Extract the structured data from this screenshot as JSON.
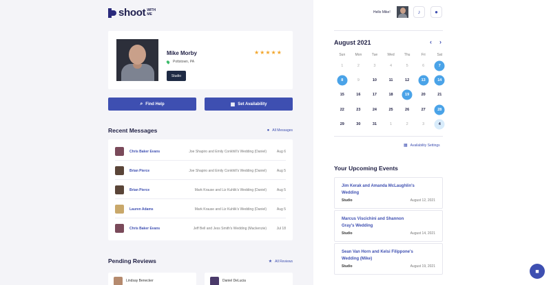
{
  "brand": {
    "name": "shoot",
    "suffix_line1": "WITH",
    "suffix_line2": "ME"
  },
  "profile": {
    "name": "Mike Morby",
    "location": "Pottstown, PA",
    "rating_stars": "★★★★★",
    "rating": 5,
    "tag": "Studio"
  },
  "actions": {
    "find_help": "Find Help",
    "set_availability": "Set Availability"
  },
  "messages": {
    "title": "Recent Messages",
    "link": "All Messages",
    "items": [
      {
        "name": "Chris Baker Evans",
        "subject": "Joe Shapiro and Emily Conkhill's Wedding (Daniel)",
        "date": "Aug 6"
      },
      {
        "name": "Brian Pierce",
        "subject": "Joe Shapiro and Emily Conkhill's Wedding (Daniel)",
        "date": "Aug 5"
      },
      {
        "name": "Brian Pierce",
        "subject": "Mark Krause and Liz Kuhlik's Wedding (Daniel)",
        "date": "Aug 5"
      },
      {
        "name": "Lauren Adams",
        "subject": "Mark Krause and Liz Kuhlik's Wedding (Daniel)",
        "date": "Aug 5"
      },
      {
        "name": "Chris Baker Evans",
        "subject": "Jeff Bell and Jess Smith's Wedding (Mackenzie)",
        "date": "Jul 18"
      }
    ]
  },
  "reviews": {
    "title": "Pending Reviews",
    "link": "All Reviews",
    "items": [
      {
        "name": "Lindsay Benecker"
      },
      {
        "name": "Daniel DeLucia"
      }
    ]
  },
  "header": {
    "greeting": "Hello Mike!"
  },
  "calendar": {
    "month": "August 2021",
    "prev": "‹",
    "next": "›",
    "weekdays": [
      "Sun",
      "Mon",
      "Tue",
      "Wed",
      "Thu",
      "Fri",
      "Sat"
    ],
    "weeks": [
      [
        {
          "d": "1",
          "s": "muted"
        },
        {
          "d": "2",
          "s": "muted"
        },
        {
          "d": "3",
          "s": "muted"
        },
        {
          "d": "4",
          "s": "muted"
        },
        {
          "d": "5",
          "s": "muted"
        },
        {
          "d": "6",
          "s": "muted"
        },
        {
          "d": "7",
          "s": "hl"
        }
      ],
      [
        {
          "d": "8",
          "s": "hl"
        },
        {
          "d": "9",
          "s": "muted"
        },
        {
          "d": "10",
          "s": ""
        },
        {
          "d": "11",
          "s": ""
        },
        {
          "d": "12",
          "s": ""
        },
        {
          "d": "13",
          "s": "hl"
        },
        {
          "d": "14",
          "s": "hl"
        }
      ],
      [
        {
          "d": "15",
          "s": ""
        },
        {
          "d": "16",
          "s": ""
        },
        {
          "d": "17",
          "s": ""
        },
        {
          "d": "18",
          "s": ""
        },
        {
          "d": "19",
          "s": "hl"
        },
        {
          "d": "20",
          "s": ""
        },
        {
          "d": "21",
          "s": ""
        }
      ],
      [
        {
          "d": "22",
          "s": ""
        },
        {
          "d": "23",
          "s": ""
        },
        {
          "d": "24",
          "s": ""
        },
        {
          "d": "25",
          "s": ""
        },
        {
          "d": "26",
          "s": ""
        },
        {
          "d": "27",
          "s": ""
        },
        {
          "d": "28",
          "s": "hl"
        }
      ],
      [
        {
          "d": "29",
          "s": ""
        },
        {
          "d": "30",
          "s": ""
        },
        {
          "d": "31",
          "s": ""
        },
        {
          "d": "1",
          "s": "muted"
        },
        {
          "d": "2",
          "s": "muted"
        },
        {
          "d": "3",
          "s": "muted"
        },
        {
          "d": "4",
          "s": "lt"
        }
      ]
    ],
    "settings_link": "Availability Settings"
  },
  "events": {
    "title": "Your Upcoming Events",
    "items": [
      {
        "name": "Jim Kerak and Amanda McLaughlin's Wedding",
        "type": "Studio",
        "date": "August 12, 2021"
      },
      {
        "name": "Marcus Viscichini and Shannon Gray's Wedding",
        "type": "Studio",
        "date": "August 14, 2021"
      },
      {
        "name": "Sean Van Horn and Kelsi Filippone's Wedding (Mike)",
        "type": "Studio",
        "date": "August 19, 2021"
      }
    ]
  },
  "colors": {
    "accent": "#3e4fb1",
    "highlight": "#4aa3e8",
    "star": "#f2a52a"
  },
  "icons": [
    "search-icon",
    "calendar-icon",
    "chat-icon",
    "star-icon",
    "bell-icon",
    "pin-icon"
  ]
}
